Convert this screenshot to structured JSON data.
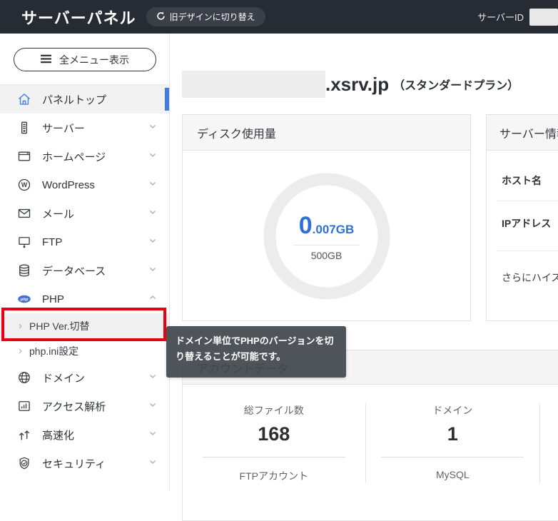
{
  "header": {
    "app_title": "サーバーパネル",
    "switch_button_label": "旧デザインに切り替え",
    "server_id_label": "サーバーID"
  },
  "sidebar": {
    "menu_toggle_label": "全メニュー表示",
    "sub_arrow": "›",
    "items": [
      {
        "label": "パネルトップ",
        "active": true
      },
      {
        "label": "サーバー"
      },
      {
        "label": "ホームページ"
      },
      {
        "label": "WordPress"
      },
      {
        "label": "メール"
      },
      {
        "label": "FTP"
      },
      {
        "label": "データベース"
      },
      {
        "label": "PHP",
        "expanded": true
      },
      {
        "label": "ドメイン"
      },
      {
        "label": "アクセス解析"
      },
      {
        "label": "高速化"
      },
      {
        "label": "セキュリティ"
      }
    ],
    "php_subitems": [
      {
        "label": "PHP Ver.切替",
        "highlighted": true
      },
      {
        "label": "php.ini設定"
      }
    ]
  },
  "main": {
    "title": {
      "domain_suffix": ".xsrv.jp",
      "plan": "（スタンダードプラン）"
    },
    "disk_card": {
      "title": "ディスク使用量",
      "used_int": "0",
      "used_frac": ".007GB",
      "total": "500GB"
    },
    "server_card": {
      "title": "サーバー情報",
      "row1": "ホスト名",
      "row2": "IPアドレス",
      "promo": "さらにハイス"
    },
    "account_card": {
      "title": "アカウントデータ",
      "stats": [
        {
          "label": "総ファイル数",
          "value": "168",
          "label2": "FTPアカウント"
        },
        {
          "label": "ドメイン",
          "value": "1",
          "label2": "MySQL"
        }
      ]
    }
  },
  "tooltip": {
    "text": "ドメイン単位でPHPのバージョンを切\nり替えることが可能です。"
  },
  "icons": {
    "php_logo_text": "php",
    "wordpress_letter": "W"
  },
  "colors": {
    "header_bg": "#272b33",
    "accent_blue": "#3e7de8",
    "value_blue": "#2e6fd8",
    "annotation_red": "#e60012",
    "card_header_bg": "#f6f6f6",
    "tooltip_bg": "#42474e"
  }
}
